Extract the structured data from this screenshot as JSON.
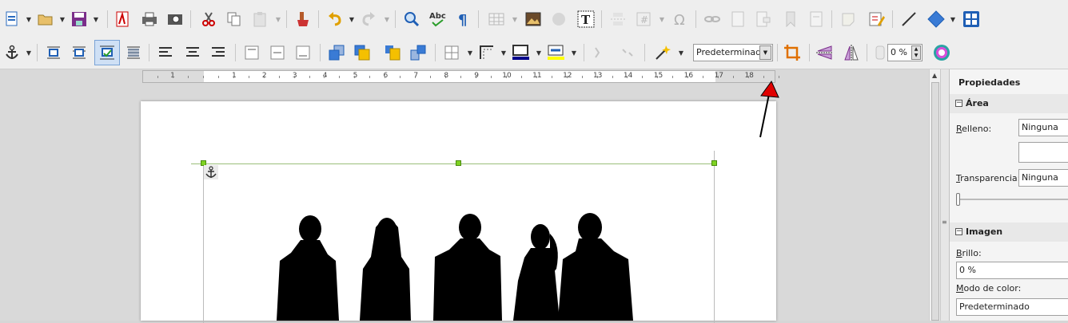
{
  "toolbar": {
    "combo_wrap": "Predeterminado",
    "transparency_value": "0 %"
  },
  "ruler": {
    "ticks": [
      "1",
      "1",
      "2",
      "3",
      "4",
      "5",
      "6",
      "7",
      "8",
      "9",
      "10",
      "11",
      "12",
      "13",
      "14",
      "15",
      "16",
      "17",
      "18"
    ]
  },
  "sidebar": {
    "title": "Propiedades",
    "area": {
      "heading": "Área",
      "fill_label": "Relleno:",
      "fill_value": "Ninguna",
      "transparency_label": "Transparencia:",
      "transparency_value": "Ninguna"
    },
    "image": {
      "heading": "Imagen",
      "brightness_label": "Brillo:",
      "brightness_value": "0 %",
      "color_mode_label": "Modo de color:",
      "color_mode_value": "Predeterminado"
    }
  },
  "colors": {
    "accent_blue": "#1f5fb5",
    "handle_green": "#7ed321",
    "arrow_red": "#e00000"
  }
}
